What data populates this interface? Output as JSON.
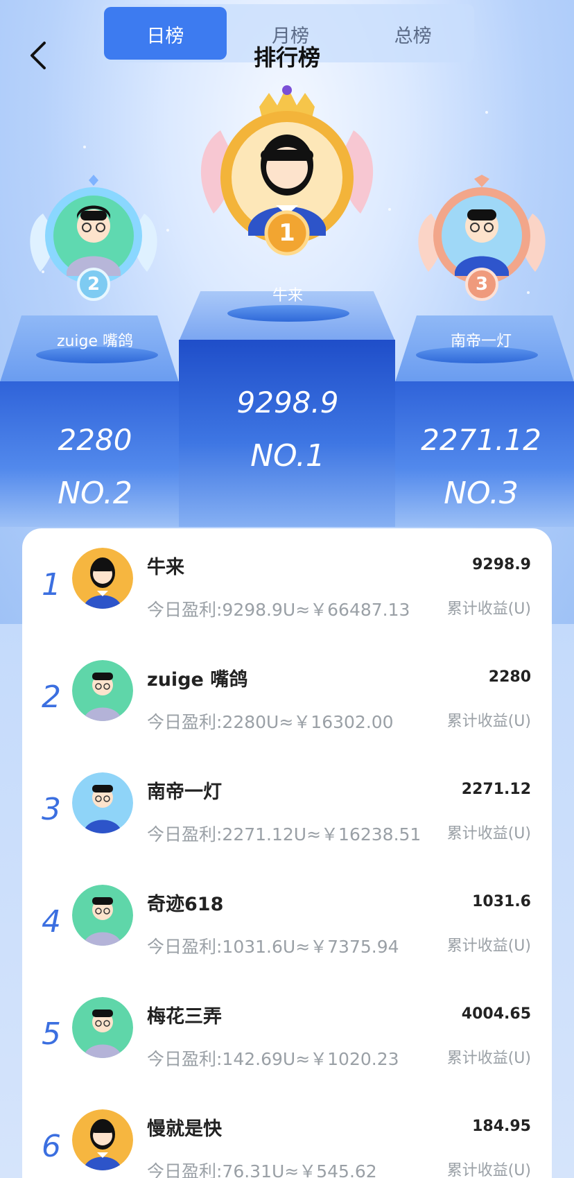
{
  "header": {
    "title": "排行榜",
    "tabs": [
      {
        "label": "日榜",
        "active": true
      },
      {
        "label": "月榜",
        "active": false
      },
      {
        "label": "总榜",
        "active": false
      }
    ]
  },
  "podium": {
    "first": {
      "name": "牛来",
      "score": "9298.9",
      "rank": "NO.1",
      "badge": "1"
    },
    "second": {
      "name": "zuige 嘴鸽",
      "score": "2280",
      "rank": "NO.2",
      "badge": "2"
    },
    "third": {
      "name": "南帝一灯",
      "score": "2271.12",
      "rank": "NO.3",
      "badge": "3"
    }
  },
  "list": [
    {
      "rank": "1",
      "name": "牛来",
      "score": "9298.9",
      "detail": "今日盈利:9298.9U≈￥66487.13",
      "cum_label": "累计收益(U)",
      "avatar": "girl-avatar"
    },
    {
      "rank": "2",
      "name": "zuige 嘴鸽",
      "score": "2280",
      "detail": "今日盈利:2280U≈￥16302.00",
      "cum_label": "累计收益(U)",
      "avatar": "boy-green-avatar"
    },
    {
      "rank": "3",
      "name": "南帝一灯",
      "score": "2271.12",
      "detail": "今日盈利:2271.12U≈￥16238.51",
      "cum_label": "累计收益(U)",
      "avatar": "boy-blue-avatar"
    },
    {
      "rank": "4",
      "name": "奇迹618",
      "score": "1031.6",
      "detail": "今日盈利:1031.6U≈￥7375.94",
      "cum_label": "累计收益(U)",
      "avatar": "boy-green-avatar"
    },
    {
      "rank": "5",
      "name": "梅花三弄",
      "score": "4004.65",
      "detail": "今日盈利:142.69U≈￥1020.23",
      "cum_label": "累计收益(U)",
      "avatar": "boy-green-avatar"
    },
    {
      "rank": "6",
      "name": "慢就是快",
      "score": "184.95",
      "detail": "今日盈利:76.31U≈￥545.62",
      "cum_label": "累计收益(U)",
      "avatar": "girl-avatar"
    }
  ],
  "colors": {
    "accent": "#3d7bf0",
    "gold": "#f5b53b",
    "silver_green": "#4fd1a5",
    "bronze": "#f0a07e",
    "rank_text": "#3b6fe0"
  },
  "icons": {
    "back": "chevron-left-icon"
  }
}
